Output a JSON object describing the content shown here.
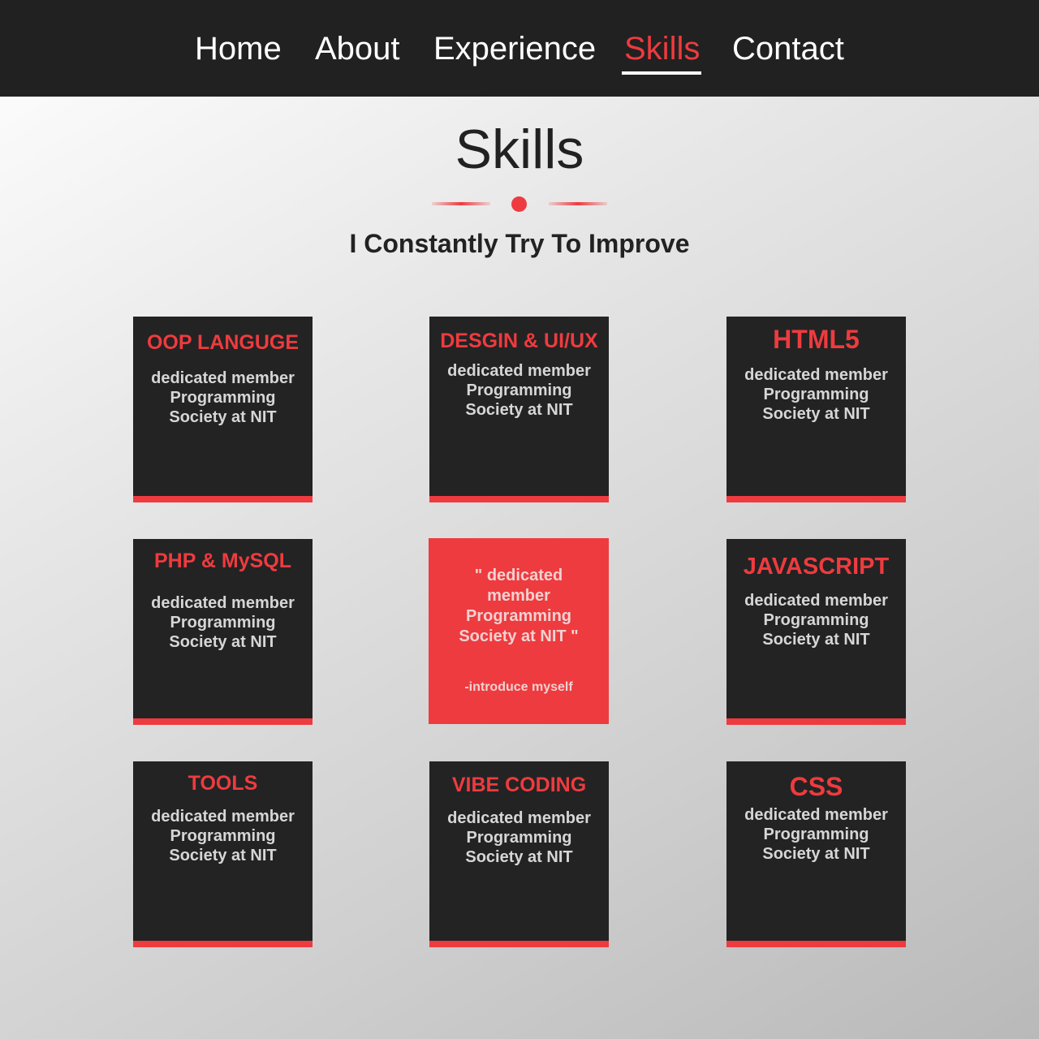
{
  "nav": {
    "items": [
      {
        "label": "Home"
      },
      {
        "label": "About"
      },
      {
        "label": "Experience"
      },
      {
        "label": "Skills"
      },
      {
        "label": "Contact"
      }
    ],
    "active": "Skills"
  },
  "section": {
    "title": "Skills",
    "subtitle": "I Constantly Try To Improve"
  },
  "colors": {
    "accent": "#ee3b3f",
    "card_bg": "#232323",
    "nav_bg": "#212121"
  },
  "cards": [
    {
      "title": "OOP LANGUGE",
      "desc": [
        "dedicated member",
        "Programming",
        "Society at NIT"
      ]
    },
    {
      "title": "DESGIN & UI/UX",
      "desc": [
        "dedicated member",
        "Programming",
        "Society at NIT"
      ]
    },
    {
      "title": "HTML5",
      "desc": [
        "dedicated member",
        "Programming",
        "Society at NIT"
      ]
    },
    {
      "title": "PHP & MySQL",
      "desc": [
        "dedicated member",
        "Programming",
        "Society at NIT"
      ]
    },
    {
      "title": "JAVASCRIPT",
      "desc": [
        "dedicated member",
        "Programming",
        "Society at NIT"
      ]
    },
    {
      "title": "TOOLS",
      "desc": [
        "dedicated member",
        "Programming",
        "Society at NIT"
      ]
    },
    {
      "title": "VIBE CODING",
      "desc": [
        "dedicated member",
        "Programming",
        "Society at NIT"
      ]
    },
    {
      "title": "CSS",
      "desc": [
        "dedicated member",
        "Programming",
        "Society at NIT"
      ]
    }
  ],
  "quote": {
    "lines": [
      "\" dedicated",
      "member",
      "Programming",
      "Society at NIT \""
    ],
    "signature": "-introduce myself"
  }
}
